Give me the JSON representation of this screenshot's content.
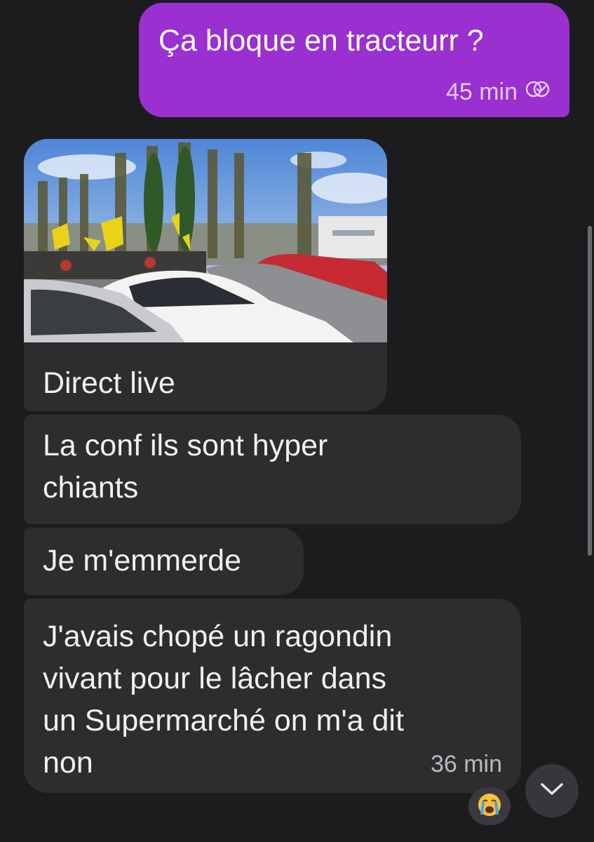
{
  "messages": {
    "outgoing": {
      "text": "Ça bloque en tracteurr ?",
      "time": "45 min",
      "status_icon": "read-receipt-icon"
    },
    "image_message": {
      "caption": "Direct live"
    },
    "msg2": {
      "line1": "La conf ils sont hyper",
      "line2": "chiants"
    },
    "msg3": {
      "text": "Je m'emmerde"
    },
    "msg4": {
      "line1": "J'avais chopé un ragondin",
      "line2": "vivant pour le lâcher dans",
      "line3": "un Supermarché on m'a dit",
      "line4": "non",
      "time": "36 min"
    },
    "reaction": "😭"
  },
  "colors": {
    "background": "#1c1c1f",
    "outgoing_bubble": "#9930cf",
    "incoming_bubble": "#2d2d30"
  },
  "controls": {
    "scroll_down_icon": "chevron-down-icon"
  }
}
